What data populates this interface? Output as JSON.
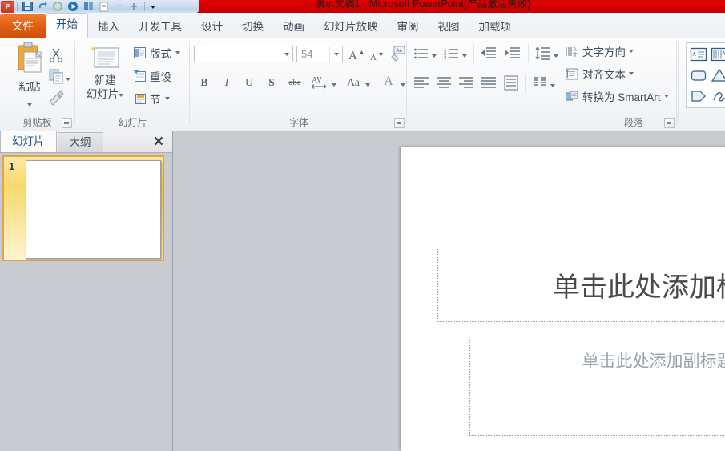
{
  "window": {
    "title": "演示文稿1 - Microsoft PowerPoint(产品激活失败)",
    "titlebar_color": "#d40000",
    "quick_access": [
      {
        "name": "app-icon",
        "label": "P"
      },
      {
        "name": "save-icon",
        "label": "保存"
      },
      {
        "name": "undo-icon",
        "label": "撤消"
      },
      {
        "name": "redo-icon",
        "label": "恢复"
      },
      {
        "name": "start-slideshow-icon",
        "label": "从头开始"
      },
      {
        "name": "new-icon",
        "label": "新建"
      },
      {
        "name": "open-icon",
        "label": "打开"
      },
      {
        "name": "print-icon",
        "label": "快速打印"
      },
      {
        "name": "customize-qat-icon",
        "label": "自定义快速访问工具栏"
      }
    ]
  },
  "tabs": [
    {
      "label": "文件",
      "kind": "file"
    },
    {
      "label": "开始",
      "kind": "active"
    },
    {
      "label": "插入",
      "kind": "normal"
    },
    {
      "label": "开发工具",
      "kind": "normal"
    },
    {
      "label": "设计",
      "kind": "normal"
    },
    {
      "label": "切换",
      "kind": "normal"
    },
    {
      "label": "动画",
      "kind": "normal"
    },
    {
      "label": "幻灯片放映",
      "kind": "normal"
    },
    {
      "label": "审阅",
      "kind": "normal"
    },
    {
      "label": "视图",
      "kind": "normal"
    },
    {
      "label": "加载项",
      "kind": "normal"
    }
  ],
  "ribbon": {
    "clipboard": {
      "group_label": "剪贴板",
      "paste_label": "粘贴",
      "cut_label": "剪切",
      "copy_label": "复制",
      "format_painter_label": "格式刷"
    },
    "slides": {
      "group_label": "幻灯片",
      "new_slide_line1": "新建",
      "new_slide_line2": "幻灯片",
      "layout_label": "版式",
      "reset_label": "重设",
      "section_label": "节"
    },
    "font": {
      "group_label": "字体",
      "font_name_value": "",
      "font_name_placeholder": "",
      "font_size_value": "54",
      "grow_font_label": "增大字号",
      "shrink_font_label": "减小字号",
      "clear_format_label": "清除所有格式",
      "bold_label": "B",
      "italic_label": "I",
      "underline_label": "U",
      "shadow_label": "S",
      "strikethrough_label": "abc",
      "spacing_label": "AV",
      "case_label": "Aa",
      "font_color_label": "A"
    },
    "paragraph": {
      "group_label": "段落",
      "bullets_label": "项目符号",
      "numbering_label": "编号",
      "decrease_indent_label": "减少缩进量",
      "increase_indent_label": "增加缩进量",
      "line_spacing_label": "行距",
      "text_direction_label": "文字方向",
      "align_text_label": "对齐文本",
      "convert_smartart_label": "转换为 SmartArt",
      "align_left_label": "左对齐",
      "align_center_label": "居中",
      "align_right_label": "右对齐",
      "justify_label": "两端对齐",
      "text_columns_label": "分栏"
    },
    "drawing": {
      "shapes": [
        "text-box-shape",
        "vertical-text-shape",
        "rounded-rect-shape",
        "triangle-shape",
        "pentagon-shape",
        "scribble-shape"
      ]
    }
  },
  "left_panel": {
    "tab_slides": "幻灯片",
    "tab_outline": "大纲",
    "close_label": "✕",
    "slides": [
      {
        "number": "1",
        "selected": true
      }
    ]
  },
  "slide": {
    "title_placeholder": "单击此处添加标题",
    "subtitle_placeholder": "单击此处添加副标题"
  }
}
